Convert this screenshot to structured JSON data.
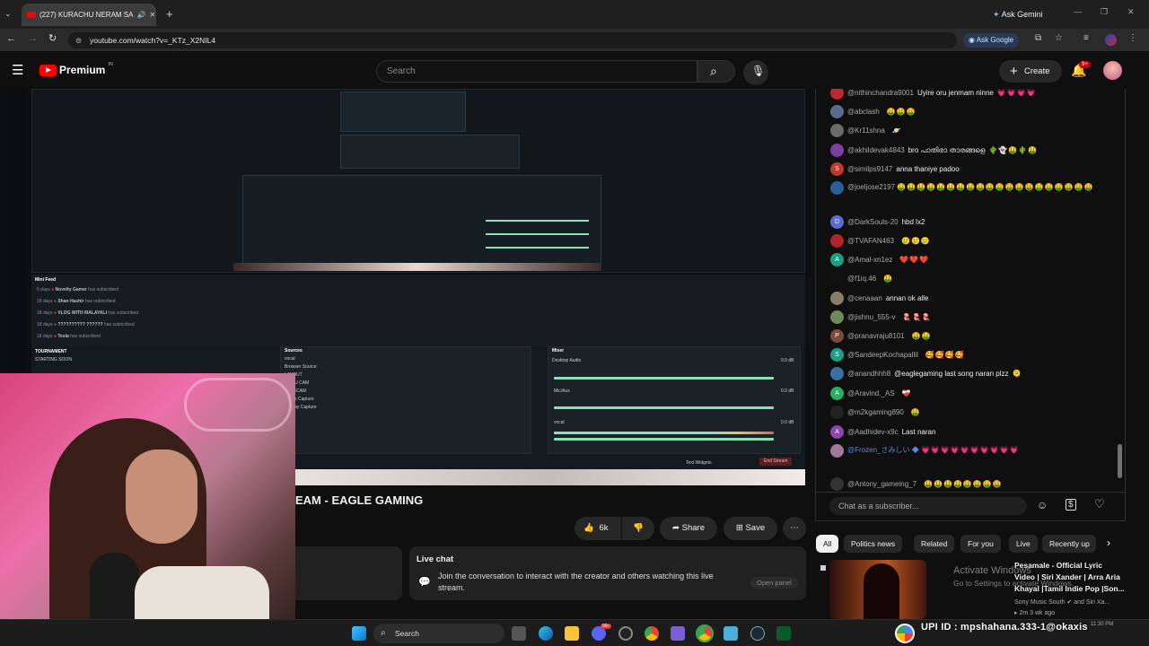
{
  "browser": {
    "tab_title": "(227) KURACHU NERAM SA",
    "url": "youtube.com/watch?v=_KTz_X2NIL4",
    "ask_gemini": "Ask Gemini",
    "ask_google": "Ask Google"
  },
  "youtube": {
    "logo_text": "Premium",
    "region": "IN",
    "search_placeholder": "Search",
    "create_label": "Create",
    "notif_count": "9+"
  },
  "obs": {
    "mini_feed": "Mini Feed",
    "feed": [
      {
        "time": "6 days",
        "name": "Novelty Gamer",
        "action": "has subscribed"
      },
      {
        "time": "18 days",
        "name": "Shan Hashir",
        "action": "has subscribed"
      },
      {
        "time": "18 days",
        "name": "VLOG WITH MALAYALI",
        "action": "has subscribed"
      },
      {
        "time": "18 days",
        "name": "?????????? ??????",
        "action": "has subscribed"
      },
      {
        "time": "18 days",
        "name": "Tesla",
        "action": "has subscribed"
      }
    ],
    "tournament": "TOURNAMENT",
    "starting_soon": "STARTING SOON",
    "sources_title": "Sources",
    "sources": [
      "vocal",
      "Browser Source",
      "LAYOUT",
      "GOKU CAM",
      "FACECAM",
      "Game Capture",
      "Display Capture"
    ],
    "mixer_title": "Mixer",
    "mixer": [
      {
        "name": "Desktop Audio",
        "db": "0.0 dB"
      },
      {
        "name": "Mic/Aux",
        "db": "0.0 dB"
      },
      {
        "name": "vocal",
        "db": "0.0 dB"
      }
    ],
    "text_widgets": "Text Widgets",
    "end_stream": "End Stream"
  },
  "video": {
    "title": "EAM - EAGLE GAMING",
    "likes": "6k",
    "share": "Share",
    "save": "Save"
  },
  "live_chat_panel": {
    "heading": "Live chat",
    "body": "Join the conversation to interact with the creator and others watching this live stream.",
    "open_panel": "Open panel"
  },
  "chat": {
    "messages": [
      {
        "author": "@nithinchandra9001",
        "text": "Uyire oru jenmam ninne",
        "emoji": "💗💗💗💗",
        "avatar": "#c0282e",
        "initial": ""
      },
      {
        "author": "@abclash",
        "text": "",
        "emoji": "🤑🤑🤑",
        "avatar": "#5a6b8c",
        "initial": ""
      },
      {
        "author": "@Kr11shna",
        "text": "",
        "emoji": "🪐",
        "avatar": "#6b6b6b",
        "initial": ""
      },
      {
        "author": "@akhildevak4843",
        "text": "bro പാതിരാ താരങ്ങളെ",
        "emoji": "🌵👻🤑🌵🤑",
        "avatar": "#7b3fa0",
        "initial": ""
      },
      {
        "author": "@similps9147",
        "text": "anna thaniye padoo",
        "emoji": "",
        "avatar": "#c0392b",
        "initial": "S"
      },
      {
        "author": "@joeljose2197",
        "text": "",
        "emoji": "🤑🤑🤑🤑🤑🤑🤑🤑🤑🤑🤑🤑🤑🤑🤑🤑🤑🤑🤑🤑",
        "avatar": "#2a5e9a",
        "initial": ""
      },
      {
        "author": "@DarkSouls-20",
        "text": "hbd lx2",
        "emoji": "",
        "avatar": "#5b6bd6",
        "initial": "D"
      },
      {
        "author": "@TVAFAN463",
        "text": "",
        "emoji": "🥲🥲🥲",
        "avatar": "#b0232a",
        "initial": ""
      },
      {
        "author": "@Amal-xn1ez",
        "text": "",
        "emoji": "❤️❤️❤️",
        "avatar": "#16a085",
        "initial": "A"
      },
      {
        "author": "@f1iq.46",
        "text": "",
        "emoji": "🤑",
        "avatar": "#111111",
        "initial": ""
      },
      {
        "author": "@cenaaan",
        "text": "annan ok alle",
        "emoji": "",
        "avatar": "#8a7c6a",
        "initial": ""
      },
      {
        "author": "@jishnu_555-v",
        "text": "",
        "emoji": "🪼🪼🪼",
        "avatar": "#6f8a5a",
        "initial": ""
      },
      {
        "author": "@pranavraju8101",
        "text": "",
        "emoji": "🤑🤑",
        "avatar": "#7d4b3a",
        "initial": "P"
      },
      {
        "author": "@SandeepKochapallil",
        "text": "",
        "emoji": "🥰🥰🥰🥰",
        "avatar": "#16a085",
        "initial": "S"
      },
      {
        "author": "@anandhhh8",
        "text": "@eaglegaming last song naran plzz",
        "emoji": "🫠",
        "avatar": "#3b6fa0",
        "initial": ""
      },
      {
        "author": "@Aravind._AS",
        "text": "",
        "emoji": "❤️‍🩹",
        "avatar": "#27ae60",
        "initial": "A"
      },
      {
        "author": "@m2kgaming890",
        "text": "",
        "emoji": "🤑",
        "avatar": "#222222",
        "initial": ""
      },
      {
        "author": "@Aadhidev-x9c",
        "text": "Last naran",
        "emoji": "",
        "avatar": "#8e44ad",
        "initial": "A"
      },
      {
        "author": "@Frozen_さみしい",
        "text": "",
        "emoji": "💗💗💗💗💗💗💗💗💗💗",
        "avatar": "#a07898",
        "initial": ""
      },
      {
        "author": "@Antony_gameing_7",
        "text": "",
        "emoji": "🤑🤑🤑🤑🤑🤑🤑🤑",
        "avatar": "#333333",
        "initial": ""
      }
    ],
    "input_placeholder": "Chat as a subscriber..."
  },
  "chips": [
    "All",
    "Politics news",
    "Related",
    "For you",
    "Live",
    "Recently up"
  ],
  "recommended": {
    "title_line1": "Pesamale - Official Lyric",
    "title_line2": "Video | Siri Xander | Arra Aria",
    "title_line3": "Khayal |Tamil Indie Pop |Son...",
    "channel": "Sony Music South",
    "channel_suffix": "and Siri Xa...",
    "meta": "2m   3 wk ago",
    "watermark1": "Activate Windows",
    "watermark2": "Go to Settings to activate Windows."
  },
  "taskbar": {
    "search": "Search",
    "overlay": "UPI ID : mpshahana.333-1@okaxis",
    "badge": "99+",
    "time": "11:30 PM"
  },
  "colors": {
    "yt_red": "#ff0000",
    "accent_blue": "#3ea6ff",
    "chat_bg": "#0f0f0f"
  }
}
